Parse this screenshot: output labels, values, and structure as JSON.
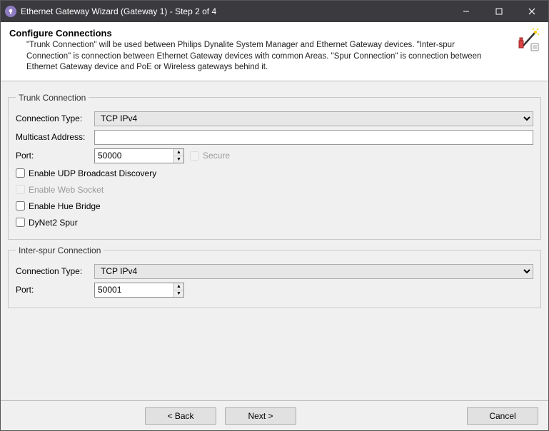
{
  "window": {
    "title": "Ethernet Gateway Wizard (Gateway 1) - Step 2 of 4"
  },
  "header": {
    "title": "Configure Connections",
    "description": "\"Trunk Connection\" will be used between Philips Dynalite System Manager and Ethernet Gateway devices. \"Inter-spur Connection\" is connection between Ethernet Gateway devices with common Areas. \"Spur Connection\" is connection between Ethernet Gateway device and PoE or Wireless gateways behind it."
  },
  "trunk": {
    "legend": "Trunk Connection",
    "labels": {
      "connection_type": "Connection Type:",
      "multicast_address": "Multicast Address:",
      "port": "Port:"
    },
    "connection_type_value": "TCP IPv4",
    "multicast_address_value": "",
    "port_value": "50000",
    "secure_label": "Secure",
    "checkboxes": {
      "udp_discovery": "Enable UDP Broadcast Discovery",
      "web_socket": "Enable Web Socket",
      "hue_bridge": "Enable Hue Bridge",
      "dynet2_spur": "DyNet2 Spur"
    }
  },
  "interspur": {
    "legend": "Inter-spur Connection",
    "labels": {
      "connection_type": "Connection Type:",
      "port": "Port:"
    },
    "connection_type_value": "TCP IPv4",
    "port_value": "50001"
  },
  "buttons": {
    "back": "<  Back",
    "next": "Next  >",
    "cancel": "Cancel"
  }
}
